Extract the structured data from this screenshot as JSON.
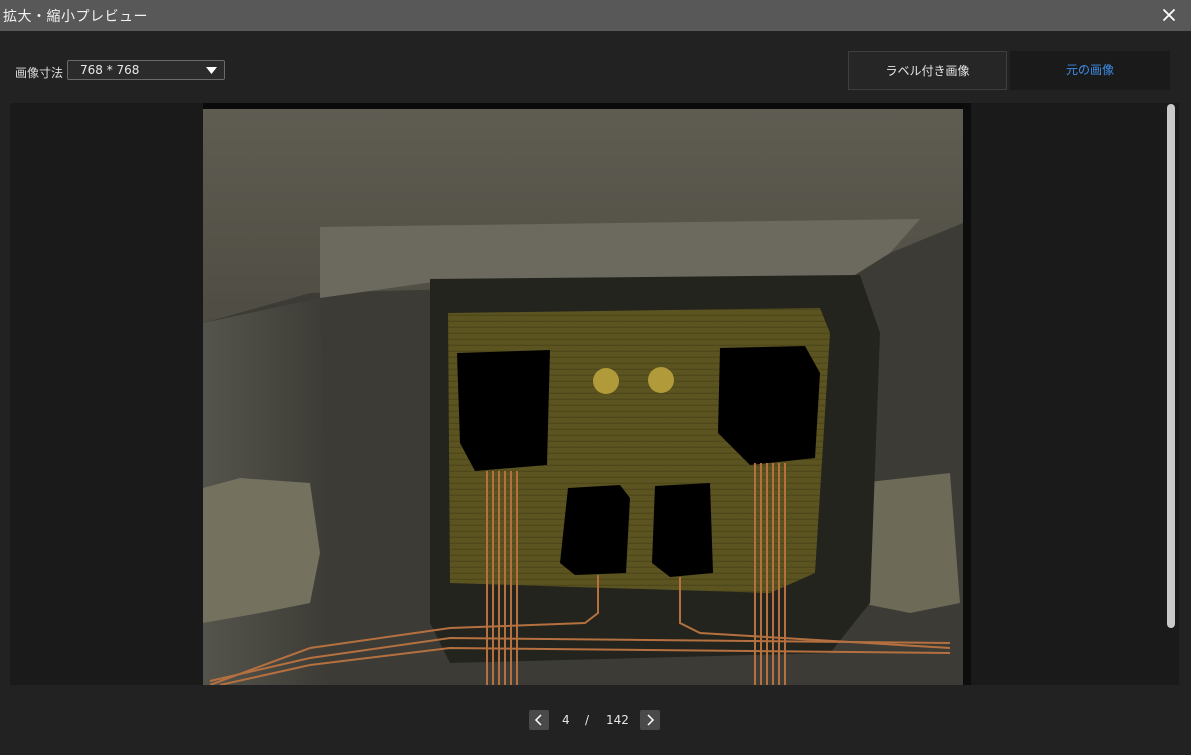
{
  "window": {
    "title": "拡大・縮小プレビュー"
  },
  "toolbar": {
    "size_label": "画像寸法",
    "size_value": "768 * 768",
    "tabs": {
      "labeled": "ラベル付き画像",
      "original": "元の画像"
    },
    "active_tab": "original",
    "accent": "#3d8ee8"
  },
  "pagination": {
    "current": "4",
    "separator": "/",
    "total": "142"
  },
  "icons": {
    "close": "close-icon",
    "dropdown": "caret-down-icon",
    "prev": "chevron-left-icon",
    "next": "chevron-right-icon"
  }
}
